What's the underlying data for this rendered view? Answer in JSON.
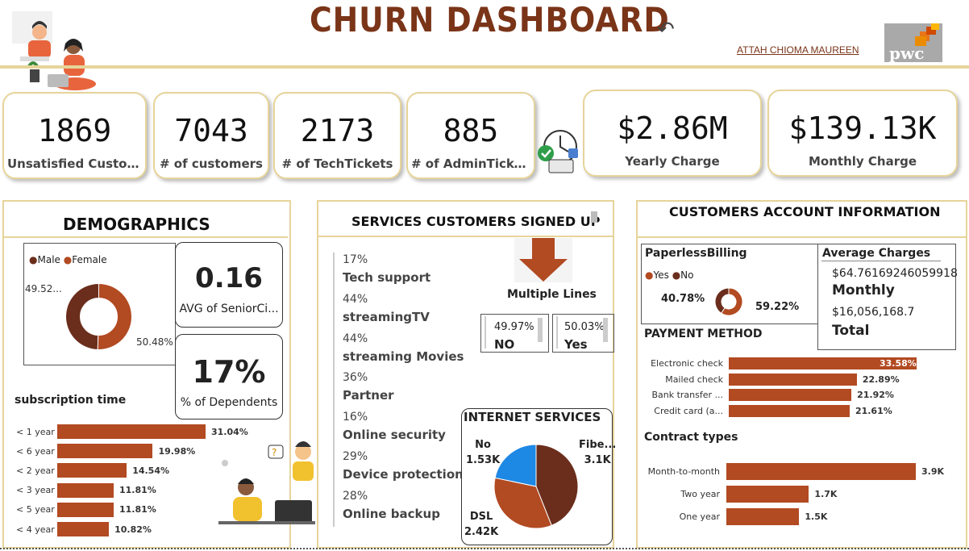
{
  "header": {
    "title": "CHURN DASHBOARD",
    "author": "ATTAH CHIOMA MAUREEN",
    "logo_text": "pwc",
    "back_icon": "back-arrow-icon"
  },
  "kpis": [
    {
      "value": "1869",
      "label": "Unsatisfied Custom..."
    },
    {
      "value": "7043",
      "label": "# of customers"
    },
    {
      "value": "2173",
      "label": "# of TechTickets"
    },
    {
      "value": "885",
      "label": "# of AdminTickets"
    },
    {
      "value": "$2.86M",
      "label": "Yearly Charge"
    },
    {
      "value": "$139.13K",
      "label": "Monthly Charge"
    }
  ],
  "demographics": {
    "title": "DEMOGRAPHICS",
    "legend": [
      "Male",
      "Female"
    ],
    "male_label": "49.52...",
    "female_label": "50.48%",
    "senior_value": "0.16",
    "senior_label": "AVG of SeniorCi...",
    "dependents_value": "17%",
    "dependents_label": "% of Dependents",
    "subscription_title": "subscription time"
  },
  "services": {
    "title": "SERVICES CUSTOMERS SIGNED UP",
    "items": [
      {
        "pct": "17%",
        "name": "Tech support"
      },
      {
        "pct": "44%",
        "name": "streamingTV"
      },
      {
        "pct": "44%",
        "name": "streaming Movies"
      },
      {
        "pct": "36%",
        "name": "Partner"
      },
      {
        "pct": "16%",
        "name": "Online security"
      },
      {
        "pct": "29%",
        "name": "Device protection"
      },
      {
        "pct": "28%",
        "name": "Online backup"
      }
    ],
    "multiple_lines_title": "Multiple Lines",
    "ml_no_value": "49.97%",
    "ml_no_label": "NO",
    "ml_yes_value": "50.03%",
    "ml_yes_label": "Yes",
    "internet_title": "INTERNET SERVICES"
  },
  "account": {
    "title": "CUSTOMERS ACCOUNT INFORMATION",
    "paperless_title": "PaperlessBilling",
    "paperless_legend": [
      "Yes",
      "No"
    ],
    "paperless_left": "40.78%",
    "paperless_right": "59.22%",
    "avg_title": "Average Charges",
    "avg_monthly_value": "$64.76169246059918",
    "avg_monthly_label": "Monthly",
    "avg_total_value": "$16,056,168.7",
    "avg_total_label": "Total",
    "payment_title": "PAYMENT METHOD",
    "contract_title": "Contract types"
  },
  "colors": {
    "accent": "#e6d49a",
    "brand_brown": "#7a3418",
    "bar": "#b24a22",
    "dark_brown": "#6b2e1c",
    "blue": "#1e88e5"
  },
  "chart_data": [
    {
      "type": "pie",
      "title": "",
      "categories": [
        "Male",
        "Female"
      ],
      "values": [
        49.52,
        50.48
      ],
      "labels": [
        "49.52...",
        "50.48%"
      ],
      "colors": [
        "#6b2e1c",
        "#b24a22"
      ]
    },
    {
      "type": "bar",
      "title": "subscription time",
      "orientation": "horizontal",
      "categories": [
        "< 1 year",
        "< 6 year",
        "< 2 year",
        "< 3 year",
        "< 5 year",
        "< 4 year"
      ],
      "values": [
        31.04,
        19.98,
        14.54,
        11.81,
        11.81,
        10.82
      ],
      "labels": [
        "31.04%",
        "19.98%",
        "14.54%",
        "11.81%",
        "11.81%",
        "10.82%"
      ]
    },
    {
      "type": "pie",
      "title": "INTERNET SERVICES",
      "categories": [
        "Fibe...",
        "DSL",
        "No"
      ],
      "values": [
        3.1,
        2.42,
        1.53
      ],
      "labels": [
        "3.1K",
        "2.42K",
        "1.53K"
      ],
      "colors": [
        "#6b2e1c",
        "#b24a22",
        "#1e88e5"
      ]
    },
    {
      "type": "pie",
      "title": "PaperlessBilling",
      "categories": [
        "Yes",
        "No"
      ],
      "values": [
        59.22,
        40.78
      ],
      "labels": [
        "59.22%",
        "40.78%"
      ],
      "colors": [
        "#b24a22",
        "#6b2e1c"
      ]
    },
    {
      "type": "bar",
      "title": "PAYMENT METHOD",
      "orientation": "horizontal",
      "categories": [
        "Electronic check",
        "Mailed check",
        "Bank transfer ...",
        "Credit card (a..."
      ],
      "values": [
        33.58,
        22.89,
        21.92,
        21.61
      ],
      "labels": [
        "33.58%",
        "22.89%",
        "21.92%",
        "21.61%"
      ]
    },
    {
      "type": "bar",
      "title": "Contract types",
      "orientation": "horizontal",
      "categories": [
        "Month-to-month",
        "Two year",
        "One year"
      ],
      "values": [
        3.9,
        1.7,
        1.5
      ],
      "labels": [
        "3.9K",
        "1.7K",
        "1.5K"
      ]
    }
  ]
}
